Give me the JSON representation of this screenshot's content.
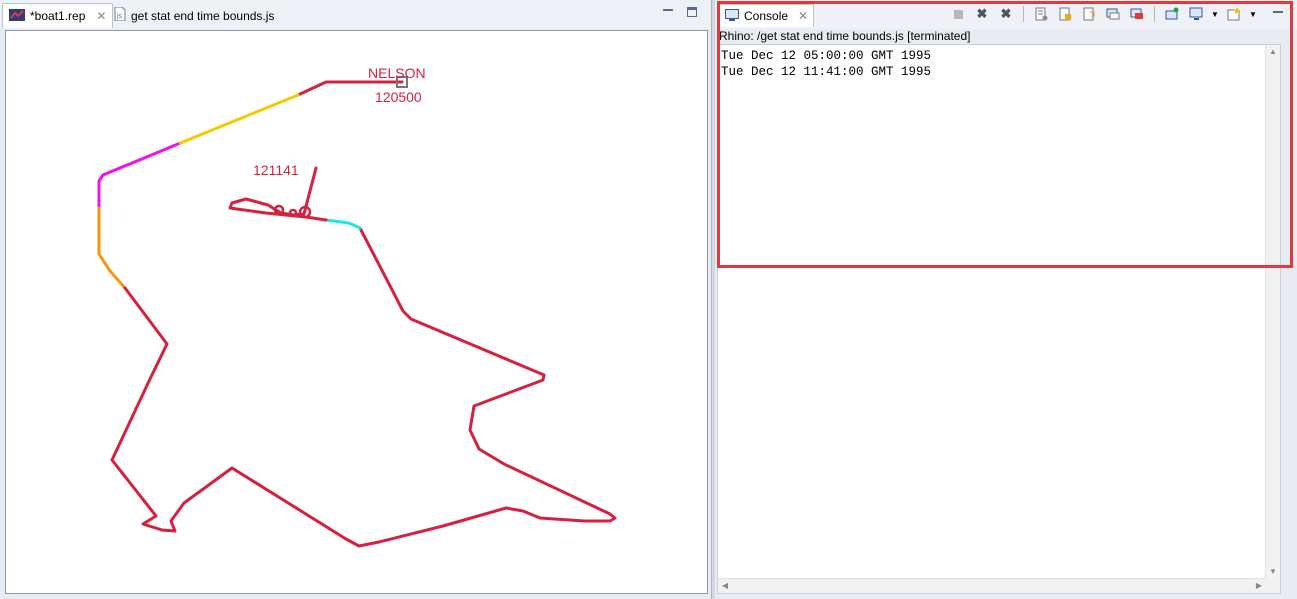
{
  "editor": {
    "tabs": [
      {
        "label": "*boat1.rep",
        "icon": "rep-file-icon",
        "active": true
      },
      {
        "label": "get stat end time bounds.js",
        "icon": "js-file-icon",
        "active": false
      }
    ]
  },
  "plot": {
    "track_name": "NELSON",
    "start_label": "120500",
    "end_label": "121141",
    "colors": {
      "track": "#d6203f",
      "yellow": "#f5c800",
      "magenta": "#f012e8",
      "orange": "#f29a0f",
      "cyan": "#1fe5ec",
      "marker": "#777777"
    }
  },
  "console": {
    "tab_label": "Console",
    "header": "Rhino: /get stat end time bounds.js [terminated]",
    "lines": [
      "Tue Dec 12 05:00:00 GMT 1995",
      "Tue Dec 12 11:41:00 GMT 1995"
    ],
    "highlight_color": "#e0393e",
    "toolbar_icons": [
      "terminate-icon",
      "remove-launch-icon",
      "remove-all-icon",
      "clear-console-icon",
      "scroll-lock-icon",
      "word-wrap-icon",
      "show-on-output-icon",
      "show-on-error-icon",
      "pin-console-icon",
      "display-console-icon",
      "open-console-icon"
    ]
  }
}
